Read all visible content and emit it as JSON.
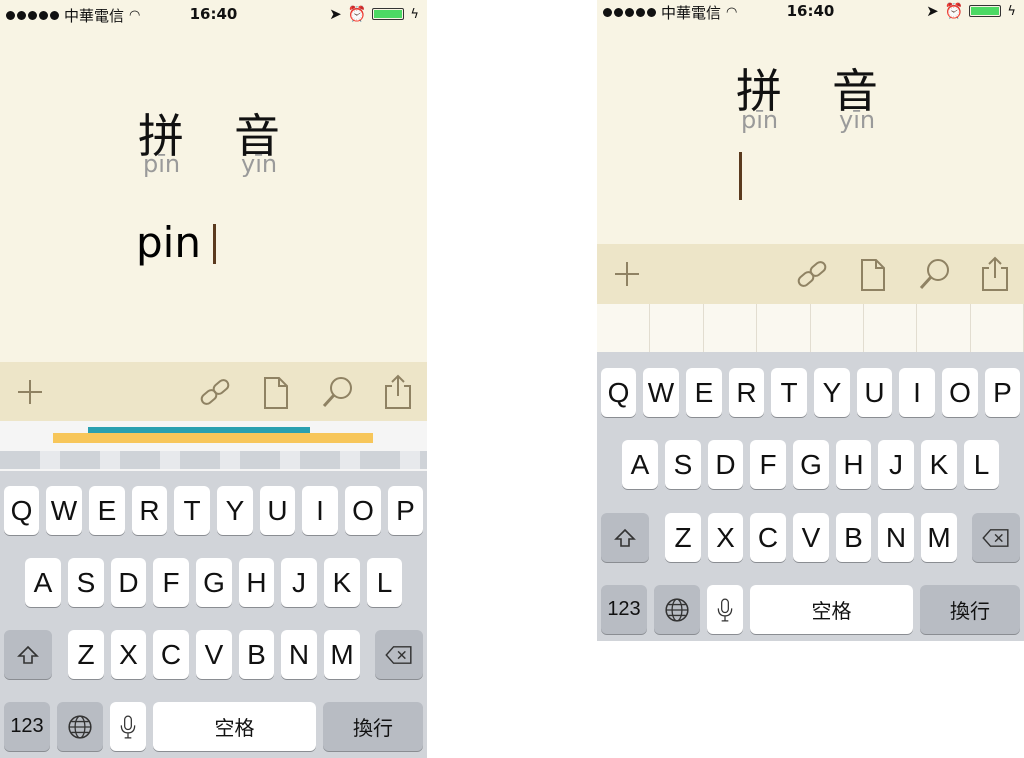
{
  "status": {
    "carrier": "中華電信",
    "time": "16:40"
  },
  "left": {
    "hanzi": [
      "拼",
      "音"
    ],
    "pinyin": [
      "pīn",
      "yīn"
    ],
    "typed": "pin"
  },
  "right": {
    "hanzi": [
      "拼",
      "音"
    ],
    "pinyin": [
      "pīn",
      "yīn"
    ]
  },
  "toolbar": {
    "icons": [
      "plus-icon",
      "link-icon",
      "document-icon",
      "search-icon",
      "share-icon"
    ]
  },
  "keyboard": {
    "row1": [
      "Q",
      "W",
      "E",
      "R",
      "T",
      "Y",
      "U",
      "I",
      "O",
      "P"
    ],
    "row2": [
      "A",
      "S",
      "D",
      "F",
      "G",
      "H",
      "J",
      "K",
      "L"
    ],
    "row3": [
      "Z",
      "X",
      "C",
      "V",
      "B",
      "N",
      "M"
    ],
    "numbers_label": "123",
    "space_label": "空格",
    "return_label": "換行"
  },
  "colors": {
    "paper": "#f8f4e4",
    "toolbar": "#ede5c8",
    "cursor": "#5b3a1e",
    "keyboard": "#d1d4d9"
  }
}
